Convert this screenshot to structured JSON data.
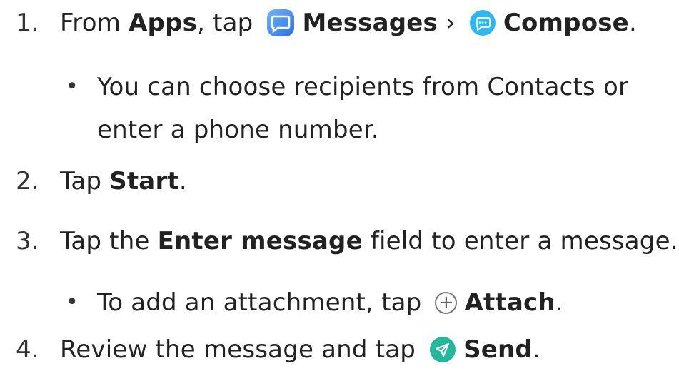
{
  "steps": [
    {
      "number": "1.",
      "from": "From ",
      "apps": "Apps",
      "tap": ", tap ",
      "messages": "Messages",
      "sep": " › ",
      "compose": "Compose",
      "end": "."
    },
    {
      "number": "2.",
      "pre": "Tap ",
      "start": "Start",
      "end": "."
    },
    {
      "number": "3.",
      "pre": "Tap the ",
      "field": "Enter message",
      "post": " field to enter a message."
    },
    {
      "number": "4.",
      "pre": "Review the message and tap ",
      "send": "Send",
      "end": "."
    }
  ],
  "subs": [
    {
      "bullet": "•",
      "text": "You can choose recipients from Contacts or enter a phone number."
    },
    {
      "bullet": "•",
      "pre": "To add an attachment, tap ",
      "attach": "Attach",
      "end": "."
    }
  ],
  "icons": {
    "messages": "messages-app-icon",
    "compose": "compose-icon",
    "attach": "plus-circle-icon",
    "send": "send-icon"
  },
  "colors": {
    "messages_icon": "#3f8cf0",
    "compose_icon": "#2fb7f5",
    "send_icon": "#22b89b"
  }
}
